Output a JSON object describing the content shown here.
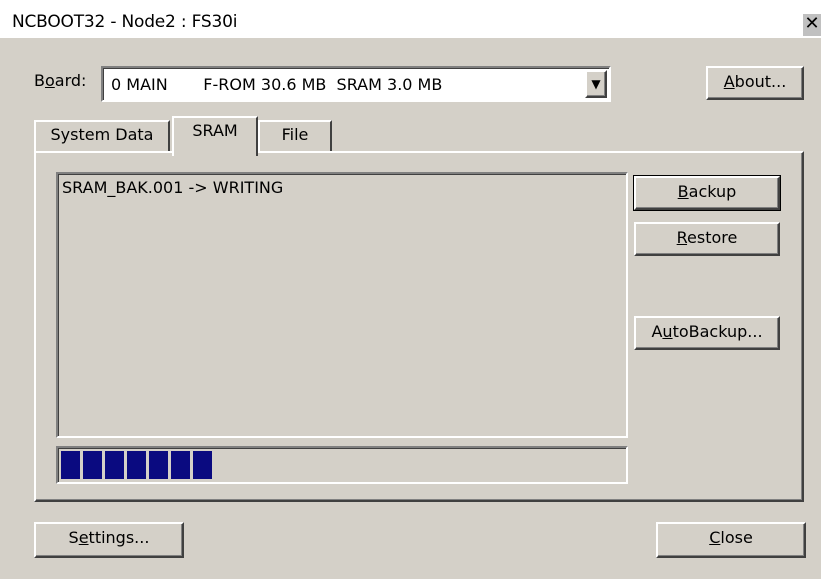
{
  "window": {
    "title": "NCBOOT32 - Node2 : FS30i",
    "close_glyph": "✕"
  },
  "board": {
    "label_pre": "B",
    "label_u": "o",
    "label_post": "ard:",
    "value": "0 MAIN       F-ROM 30.6 MB  SRAM 3.0 MB",
    "arrow": "▼"
  },
  "about_button": {
    "u": "A",
    "rest": "bout..."
  },
  "tabs": [
    {
      "label": "System Data"
    },
    {
      "label": "SRAM"
    },
    {
      "label": "File"
    }
  ],
  "log": {
    "text": "SRAM_BAK.001 -> WRITING"
  },
  "progress": {
    "percent": 28,
    "block_count": 7,
    "color": "#0a0a80"
  },
  "buttons": {
    "backup": {
      "u": "B",
      "rest": "ackup"
    },
    "restore": {
      "u": "R",
      "rest": "estore"
    },
    "autobackup": {
      "pre": "A",
      "u": "u",
      "rest": "toBackup..."
    },
    "settings": {
      "pre": "S",
      "u": "e",
      "rest": "ttings..."
    },
    "close": {
      "u": "C",
      "rest": "lose"
    }
  }
}
